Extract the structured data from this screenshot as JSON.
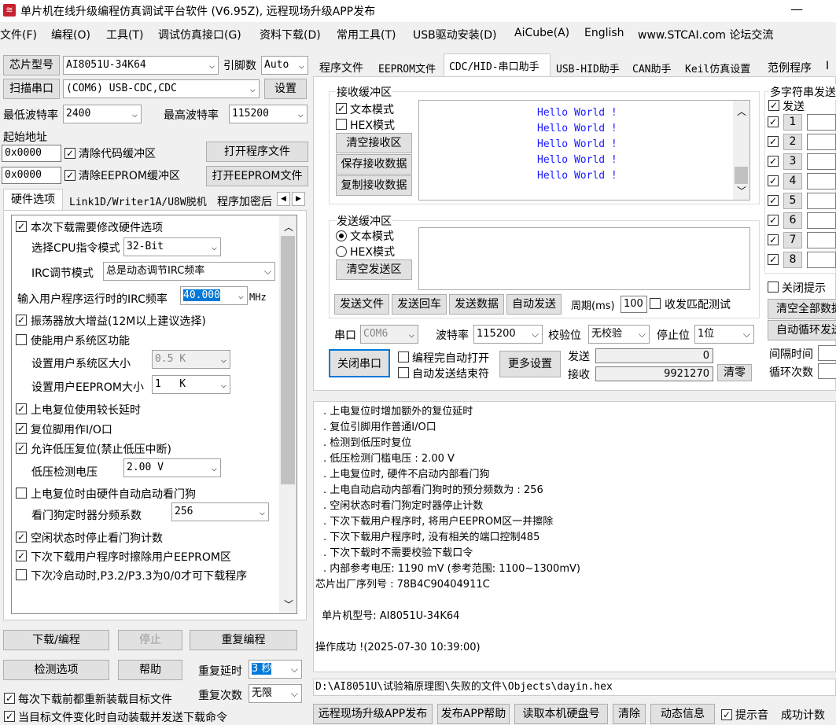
{
  "title": "单片机在线升级编程仿真调试平台软件 (V6.95Z), 远程现场升级APP发布",
  "menu": [
    "文件(F)",
    "编程(O)",
    "工具(T)",
    "调试仿真接口(G)",
    "资料下载(D)",
    "常用工具(T)",
    "USB驱动安装(D)",
    "AiCube(A)",
    "English",
    "www.STCAI.com 论坛交流"
  ],
  "left": {
    "chip_label": "芯片型号",
    "chip": "AI8051U-34K64",
    "pin_label": "引脚数",
    "pin": "Auto",
    "scan": "扫描串口",
    "port": "(COM6) USB-CDC,CDC",
    "settings": "设置",
    "minbaud_label": "最低波特率",
    "minbaud": "2400",
    "maxbaud_label": "最高波特率",
    "maxbaud": "115200",
    "start_label": "起始地址",
    "addr1": "0x0000",
    "clr_code": "清除代码缓冲区",
    "open_prog": "打开程序文件",
    "addr2": "0x0000",
    "clr_eep": "清除EEPROM缓冲区",
    "open_eep": "打开EEPROM文件",
    "tabs": [
      "硬件选项",
      "Link1D/Writer1A/U8W脱机",
      "程序加密后"
    ],
    "hw": {
      "o1": "本次下载需要修改硬件选项",
      "cpu_label": "选择CPU指令模式",
      "cpu": "32-Bit",
      "irc_label": "IRC调节模式",
      "irc": "总是动态调节IRC频率",
      "freq_label": "输入用户程序运行时的IRC频率",
      "freq": "40.000",
      "mhz": "MHz",
      "o2": "振荡器放大增益(12M以上建议选择)",
      "o3": "使能用户系统区功能",
      "sys_label": "设置用户系统区大小",
      "sys": "0.5 K",
      "eep_label": "设置用户EEPROM大小",
      "eep": "1   K",
      "o4": "上电复位使用较长延时",
      "o5": "复位脚用作I/O口",
      "o6": "允许低压复位(禁止低压中断)",
      "lv_label": "低压检测电压",
      "lv": "2.00 V",
      "o7": "上电复位时由硬件自动启动看门狗",
      "wdt_label": "看门狗定时器分频系数",
      "wdt": "256",
      "o8": "空闲状态时停止看门狗计数",
      "o9": "下次下载用户程序时擦除用户EEPROM区",
      "o10": "下次冷启动时,P3.2/P3.3为0/0才可下载程序"
    },
    "download": "下载/编程",
    "stop": "停止",
    "reprog": "重复编程",
    "detect": "检测选项",
    "help": "帮助",
    "delay_label": "重复延时",
    "delay": "3 秒",
    "count_label": "重复次数",
    "count": "无限",
    "reload": "每次下载前都重新装载目标文件",
    "autoreload": "当目标文件变化时自动装载并发送下载命令"
  },
  "tabs": [
    "程序文件",
    "EEPROM文件",
    "CDC/HID-串口助手",
    "USB-HID助手",
    "CAN助手",
    "Keil仿真设置",
    "范例程序",
    "I"
  ],
  "serial": {
    "recv_title": "接收缓冲区",
    "text_mode": "文本模式",
    "hex_mode": "HEX模式",
    "clear_recv": "清空接收区",
    "save_recv": "保存接收数据",
    "copy_recv": "复制接收数据",
    "recv_lines": [
      "Hello World !",
      "Hello World !",
      "Hello World !",
      "Hello World !",
      "Hello World !"
    ],
    "send_title": "发送缓冲区",
    "clear_send": "清空发送区",
    "send_file": "发送文件",
    "send_echo": "发送回车",
    "send_data": "发送数据",
    "auto_send": "自动发送",
    "period_label": "周期(ms)",
    "period": "100",
    "match_test": "收发匹配测试",
    "port_label": "串口",
    "port": "COM6",
    "baud_label": "波特率",
    "baud": "115200",
    "parity_label": "校验位",
    "parity": "无校验",
    "stop_label": "停止位",
    "stopbits": "1位",
    "close_port": "关闭串口",
    "open_after": "编程完自动打开",
    "close_after": "自动发送结束符",
    "more": "更多设置",
    "sent_label": "发送",
    "sent": "0",
    "recv_label": "接收",
    "recv": "9921270",
    "clear": "清零"
  },
  "multi": {
    "title": "多字符串发送",
    "send": "发送",
    "rows": [
      "1",
      "2",
      "3",
      "4",
      "5",
      "6",
      "7",
      "8"
    ],
    "close_hint": "关闭提示",
    "clear_all": "清空全部数据",
    "auto_loop": "自动循环发送",
    "interval": "间隔时间",
    "loops": "循环次数"
  },
  "log": [
    ". 上电复位时增加额外的复位延时",
    ". 复位引脚用作普通I/O口",
    ". 检测到低压时复位",
    ". 低压检测门槛电压 : 2.00 V",
    ". 上电复位时, 硬件不启动内部看门狗",
    ". 上电自动启动内部看门狗时的预分频数为 : 256",
    ". 空闲状态时看门狗定时器停止计数",
    ". 下次下载用户程序时, 将用户EEPROM区一并擦除",
    ". 下次下载用户程序时, 没有相关的端口控制485",
    ". 下次下载时不需要校验下载口令",
    ". 内部参考电压: 1190 mV (参考范围: 1100~1300mV)",
    "芯片出厂序列号 : 78B4C90404911C",
    "",
    "  单片机型号: AI8051U-34K64",
    "",
    "操作成功 !(2025-07-30 10:39:00)"
  ],
  "filepath": "D:\\AI8051U\\试验箱原理图\\失败的文件\\Objects\\dayin.hex",
  "bottom": {
    "b1": "远程现场升级APP发布",
    "b2": "发布APP帮助",
    "b3": "读取本机硬盘号",
    "b4": "清除",
    "b5": "动态信息",
    "beep": "提示音",
    "success": "成功计数"
  }
}
